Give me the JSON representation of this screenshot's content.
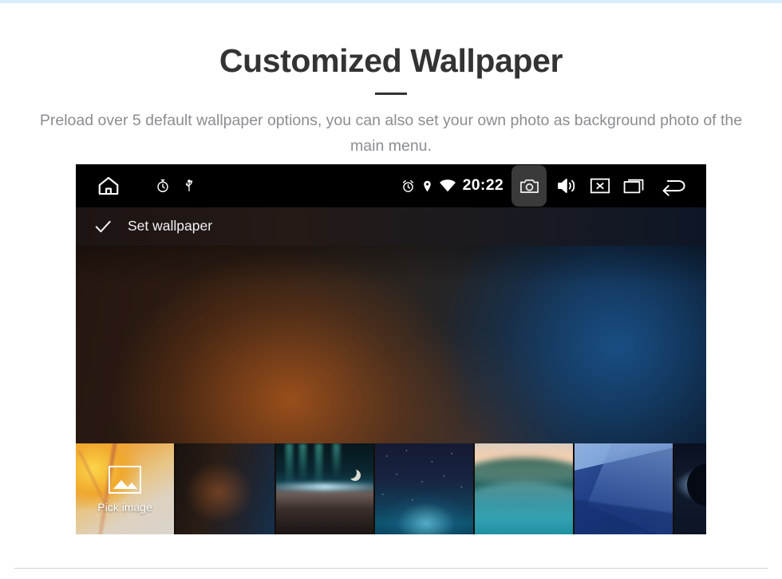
{
  "page": {
    "accent_color": "#d9eefb",
    "title": "Customized Wallpaper",
    "subtitle": "Preload over 5 default wallpaper options, you can also set your own photo as background photo of the main menu."
  },
  "device": {
    "status_bar": {
      "left_icons": [
        {
          "name": "home-icon",
          "label": "Home"
        },
        {
          "name": "timer-icon",
          "label": "Timer"
        },
        {
          "name": "usb-icon",
          "label": "USB"
        }
      ],
      "right_icons": [
        {
          "name": "alarm-icon",
          "label": "Alarm"
        },
        {
          "name": "location-icon",
          "label": "Location"
        },
        {
          "name": "wifi-icon",
          "label": "Wi-Fi"
        }
      ],
      "clock": "20:22",
      "nav_icons": [
        {
          "name": "camera-icon",
          "label": "Screenshot",
          "highlighted": true
        },
        {
          "name": "volume-icon",
          "label": "Volume"
        },
        {
          "name": "close-app-icon",
          "label": "Close"
        },
        {
          "name": "recents-icon",
          "label": "Recent apps"
        },
        {
          "name": "back-icon",
          "label": "Back"
        }
      ]
    },
    "action_bar": {
      "confirm_icon": "check-icon",
      "label": "Set wallpaper"
    },
    "preview": {
      "name": "wallpaper-preview",
      "description": "blurred warm-to-cool gradient wallpaper"
    },
    "thumbnails": [
      {
        "name": "thumbnail-pick-image",
        "label": "Pick image",
        "icon": "image-icon",
        "style": "tb-pick",
        "selected": true
      },
      {
        "name": "thumbnail-wallpaper-1",
        "label": "",
        "icon": "",
        "style": "tb-dark",
        "selected": false
      },
      {
        "name": "thumbnail-wallpaper-2",
        "label": "",
        "icon": "",
        "style": "tb-aurora",
        "selected": false
      },
      {
        "name": "thumbnail-wallpaper-3",
        "label": "",
        "icon": "",
        "style": "tb-nebula",
        "selected": false
      },
      {
        "name": "thumbnail-wallpaper-4",
        "label": "",
        "icon": "",
        "style": "tb-wave",
        "selected": false
      },
      {
        "name": "thumbnail-wallpaper-5",
        "label": "",
        "icon": "",
        "style": "tb-facet",
        "selected": false
      },
      {
        "name": "thumbnail-wallpaper-6",
        "label": "",
        "icon": "",
        "style": "tb-eclipse",
        "selected": false
      }
    ]
  }
}
